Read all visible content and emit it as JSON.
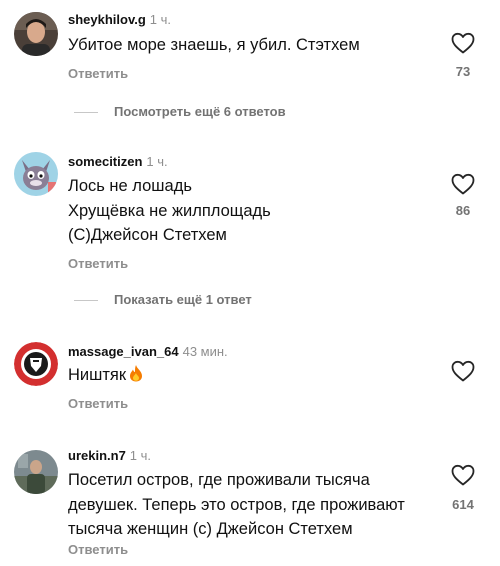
{
  "comments": [
    {
      "username": "sheykhilov.g",
      "time": "1 ч.",
      "lines": [
        "Убитое море знаешь, я убил. Стэтхем"
      ],
      "reply": "Ответить",
      "likes": "73"
    },
    {
      "username": "somecitizen",
      "time": "1 ч.",
      "lines": [
        "Лось не лошадь",
        "Хрущёвка не жилплощадь",
        "(С)Джейсон Стетхем"
      ],
      "reply": "Ответить",
      "likes": "86"
    },
    {
      "username": "massage_ivan_64",
      "time": "43 мин.",
      "lines": [
        "Ништяк"
      ],
      "reply": "Ответить",
      "likes": ""
    },
    {
      "username": "urekin.n7",
      "time": "1 ч.",
      "lines": [
        "Посетил остров, где проживали тысяча",
        "девушек. Теперь это остров, где проживают",
        "тысяча женщин (с) Джейсон Стетхем"
      ],
      "reply": "Ответить",
      "likes": "614"
    }
  ],
  "more_replies": [
    {
      "label": "Посмотреть ещё 6 ответов"
    },
    {
      "label": "Показать ещё 1 ответ"
    }
  ],
  "icons": {
    "like": "heart-outline-icon",
    "emoji": "fire-emoji"
  },
  "colors": {
    "secondary_text": "#8e8e8e",
    "count_text": "#737373",
    "divider": "#c7c7c7"
  }
}
